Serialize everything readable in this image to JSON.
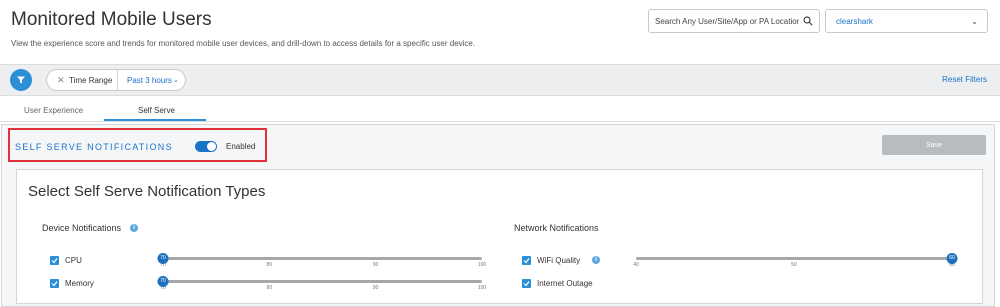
{
  "header": {
    "title": "Monitored Mobile Users",
    "description": "View the experience score and trends for monitored mobile user devices, and drill-down to access details for a specific user device.",
    "search": {
      "placeholder": "Search Any User/Site/App or PA Location",
      "icon": "search-icon"
    },
    "tenant_select": {
      "value": "clearshark"
    }
  },
  "filter_bar": {
    "filter_icon": "filter-icon",
    "pill": {
      "label": "Time Range",
      "value": "Past 3 hours"
    },
    "reset_label": "Reset Filters"
  },
  "tabs": [
    {
      "label": "User Experience",
      "active": false
    },
    {
      "label": "Self Serve",
      "active": true
    }
  ],
  "self_serve": {
    "title": "SELF SERVE NOTIFICATIONS",
    "toggle_on": true,
    "toggle_label": "Enabled",
    "save_label": "Save",
    "card_title": "Select Self Serve Notification Types",
    "device": {
      "title": "Device Notifications",
      "items": [
        {
          "label": "CPU",
          "checked": true,
          "min": 70,
          "max": 100,
          "value": 70,
          "ticks": [
            "70",
            "80",
            "90",
            "100"
          ]
        },
        {
          "label": "Memory",
          "checked": true,
          "min": 70,
          "max": 100,
          "value": 70,
          "ticks": [
            "70",
            "80",
            "90",
            "100"
          ]
        }
      ]
    },
    "network": {
      "title": "Network Notifications",
      "items": [
        {
          "label": "WiFi Quality",
          "checked": true,
          "has_info": true,
          "slider": {
            "min": 40,
            "max": 60,
            "value": 60,
            "ticks": [
              "40",
              "50",
              "60"
            ]
          }
        },
        {
          "label": "Internet Outage",
          "checked": true,
          "has_info": false
        }
      ]
    }
  },
  "colors": {
    "accent": "#1a73c7",
    "highlight_border": "#e0323b",
    "save_disabled": "#b8bcc0"
  }
}
